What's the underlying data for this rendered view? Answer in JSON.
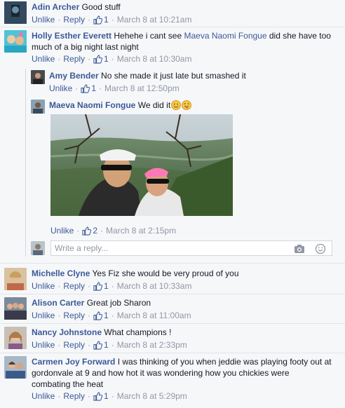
{
  "actions": {
    "unlike": "Unlike",
    "reply": "Reply",
    "dot": "·"
  },
  "comments": [
    {
      "name": "Adin Archer",
      "text": "Good stuff",
      "likes": "1",
      "time": "March 8 at 10:21am"
    },
    {
      "name": "Holly Esther Everett",
      "text_before": "Hehehe i cant see ",
      "mention": "Maeva Naomi Fongue",
      "text_after": " did she have too",
      "text_line2": "much of a big night last night",
      "likes": "1",
      "time": "March 8 at 10:30am"
    },
    {
      "name": "Michelle Clyne",
      "text": "Yes Fiz she would be very proud of you",
      "likes": "1",
      "time": "March 8 at 10:33am"
    },
    {
      "name": "Alison Carter",
      "text": "Great job Sharon",
      "likes": "1",
      "time": "March 8 at 11:00am"
    },
    {
      "name": "Nancy Johnstone",
      "text": "What champions !",
      "likes": "1",
      "time": "March 8 at 2:33pm"
    },
    {
      "name": "Carmen Joy Forward",
      "text_line1": "I was thinking of you when jeddie was playing footy out at",
      "text_line2": "gordonvale at 9 and how hot it was wondering how you chickies were",
      "text_line3": "combating the heat",
      "likes": "1",
      "time": "March 8 at 5:29pm"
    }
  ],
  "replies": [
    {
      "name": "Amy Bender",
      "text": "No she made it just late but smashed it",
      "likes": "1",
      "time": "March 8 at 12:50pm"
    },
    {
      "name": "Maeva Naomi Fongue",
      "text": "We did it",
      "likes": "2",
      "time": "March 8 at 2:15pm"
    }
  ],
  "reply_box": {
    "placeholder": "Write a reply..."
  },
  "icons": {
    "like": "thumbs-up-icon",
    "camera": "camera-icon",
    "emoji": "smiley-icon"
  },
  "colors": {
    "link": "#3b5998",
    "meta": "#9197a3",
    "background": "#f6f7f9"
  }
}
